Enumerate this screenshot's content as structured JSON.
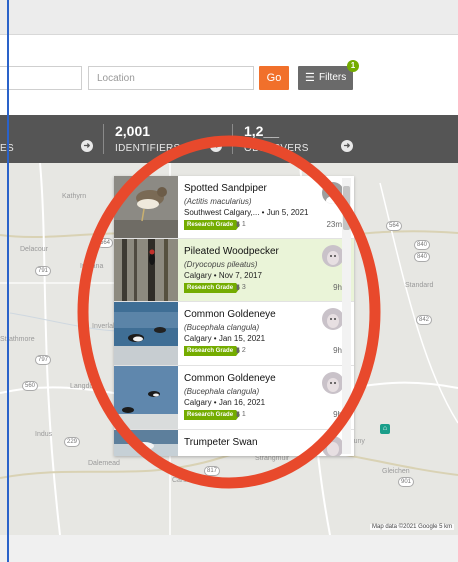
{
  "search": {
    "location_placeholder": "Location",
    "go_label": "Go",
    "filters_label": "Filters",
    "filters_badge": "1"
  },
  "stats": [
    {
      "number": "",
      "label": "ES"
    },
    {
      "number": "2,001",
      "label": "IDENTIFIERS"
    },
    {
      "number": "1,2__",
      "label": "OBSERVERS"
    }
  ],
  "map": {
    "places": [
      "Kathyrn",
      "Delacour",
      "Irricana",
      "Inverlake",
      "Langdon",
      "Indus",
      "Dalemead",
      "Carseland",
      "Strangmuir",
      "Gleichen",
      "Standard",
      "Cluny",
      "Strathmore"
    ],
    "roads": [
      "564",
      "791",
      "797",
      "560",
      "229",
      "817",
      "901",
      "840",
      "842",
      "564",
      "840"
    ],
    "attribution": "Map data ©2021 Google   5 km"
  },
  "observations": [
    {
      "common": "Spotted Sandpiper",
      "scientific": "(Actitis macularius)",
      "place": "Southwest Calgary,... • Jun 5, 2021",
      "grade": "Research Grade",
      "ids": "1",
      "ago": "23m"
    },
    {
      "common": "Pileated Woodpecker",
      "scientific": "(Dryocopus pileatus)",
      "place": "Calgary • Nov 7, 2017",
      "grade": "Research Grade",
      "ids": "3",
      "ago": "9h"
    },
    {
      "common": "Common Goldeneye",
      "scientific": "(Bucephala clangula)",
      "place": "Calgary • Jan 15, 2021",
      "grade": "Research Grade",
      "ids": "2",
      "ago": "9h"
    },
    {
      "common": "Common Goldeneye",
      "scientific": "(Bucephala clangula)",
      "place": "Calgary • Jan 16, 2021",
      "grade": "Research Grade",
      "ids": "1",
      "ago": "9h"
    },
    {
      "common": "Trumpeter Swan",
      "scientific": "",
      "place": "",
      "grade": "",
      "ids": "",
      "ago": ""
    }
  ],
  "colors": {
    "accent_orange": "#f1702b",
    "research_green": "#74ac00",
    "stats_bar": "#555555",
    "annotation_ring": "#e8492c"
  }
}
